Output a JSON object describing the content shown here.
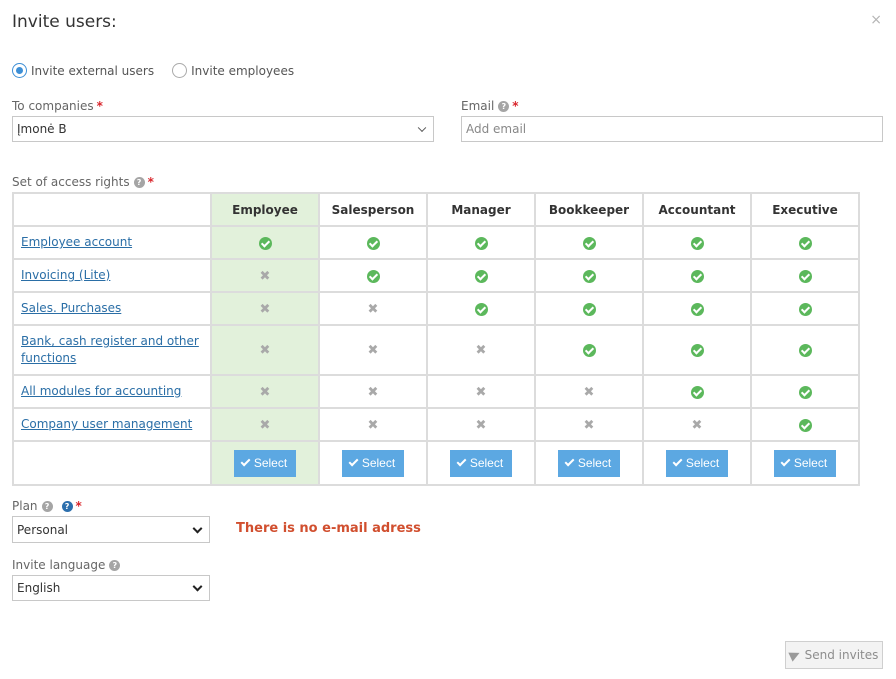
{
  "dialog": {
    "title": "Invite users:",
    "close_icon": "×"
  },
  "invite_type": [
    {
      "label": "Invite external users",
      "selected": true
    },
    {
      "label": "Invite employees",
      "selected": false
    }
  ],
  "companies": {
    "label": "To companies",
    "value": "Įmonė B"
  },
  "email": {
    "label": "Email",
    "placeholder": "Add email",
    "value": ""
  },
  "rights": {
    "label": "Set of access rights",
    "roles": [
      "Employee",
      "Salesperson",
      "Manager",
      "Bookkeeper",
      "Accountant",
      "Executive"
    ],
    "highlighted_role": "Employee",
    "rows": [
      {
        "name": "Employee account",
        "access": [
          true,
          true,
          true,
          true,
          true,
          true
        ]
      },
      {
        "name": "Invoicing (Lite)",
        "access": [
          false,
          true,
          true,
          true,
          true,
          true
        ]
      },
      {
        "name": "Sales. Purchases",
        "access": [
          false,
          false,
          true,
          true,
          true,
          true
        ]
      },
      {
        "name": "Bank, cash register and other functions",
        "access": [
          false,
          false,
          false,
          true,
          true,
          true
        ]
      },
      {
        "name": "All modules for accounting",
        "access": [
          false,
          false,
          false,
          false,
          true,
          true
        ]
      },
      {
        "name": "Company user management",
        "access": [
          false,
          false,
          false,
          false,
          false,
          true
        ]
      }
    ],
    "select_label": "Select"
  },
  "plan": {
    "label": "Plan",
    "value": "Personal"
  },
  "error_message": "There is no e-mail adress",
  "language": {
    "label": "Invite language",
    "value": "English"
  },
  "send_label": "Send invites",
  "colors": {
    "accent": "#5ca8e2",
    "check": "#5cb85c",
    "error": "#d14f2f",
    "highlight": "#e2f1db",
    "link": "#2a6ea6"
  }
}
